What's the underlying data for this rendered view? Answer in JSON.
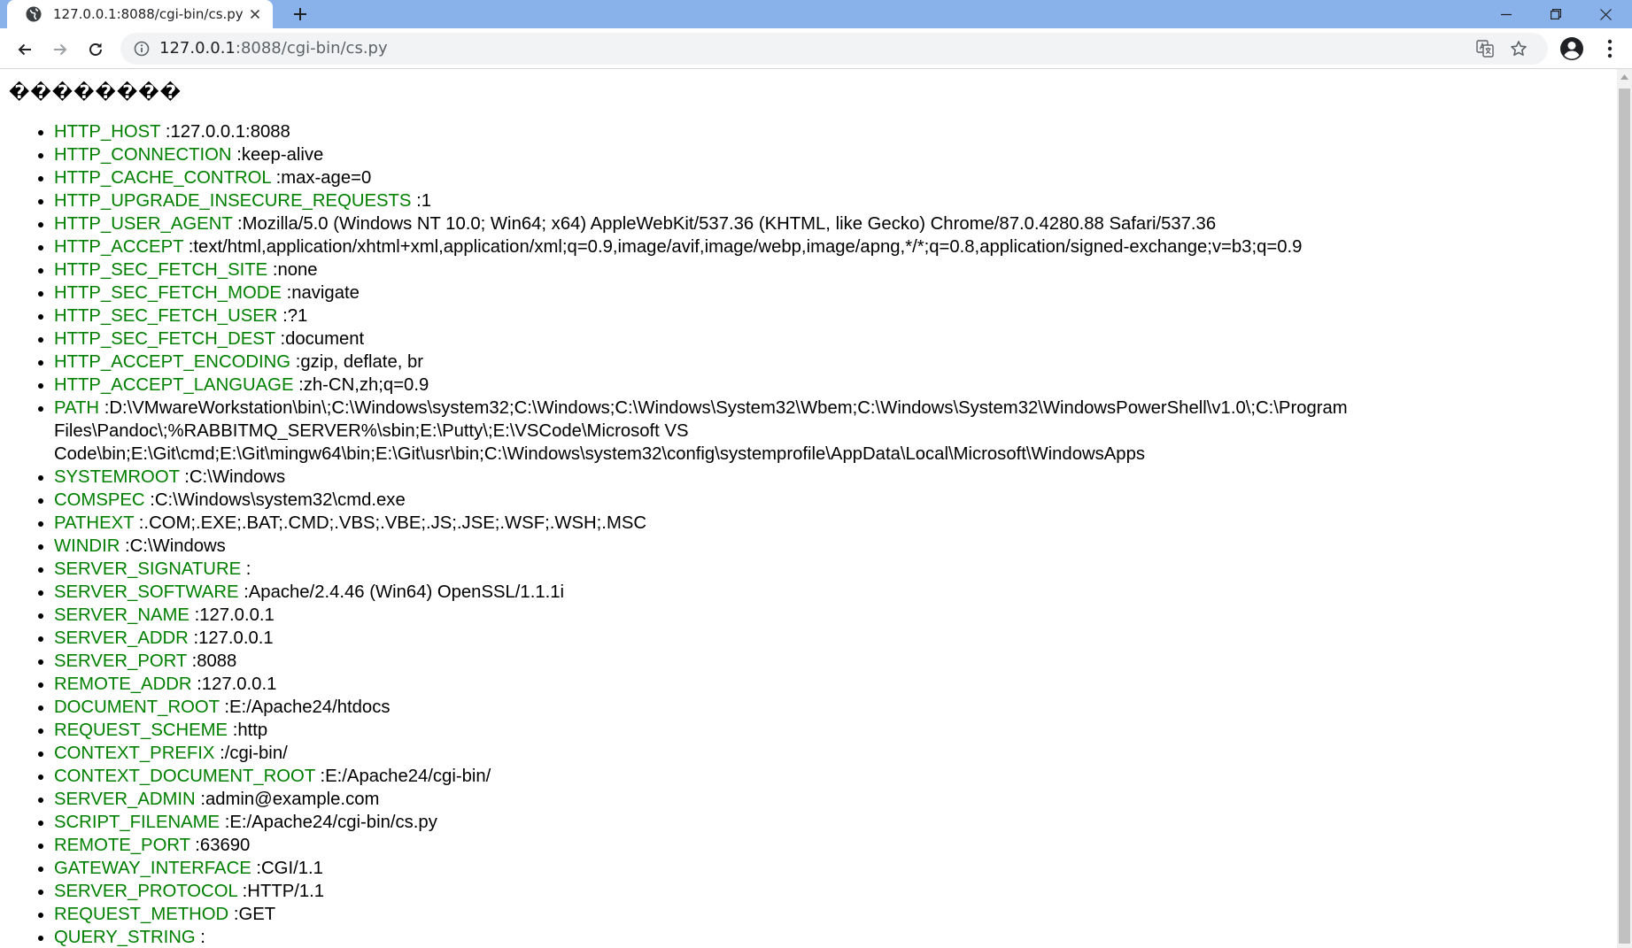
{
  "tab": {
    "title": "127.0.0.1:8088/cgi-bin/cs.py",
    "favicon": "globe-icon"
  },
  "address_bar": {
    "url_host": "127.0.0.1",
    "url_rest": ":8088/cgi-bin/cs.py"
  },
  "icons": {
    "back": "arrow-left-icon",
    "forward": "arrow-right-icon",
    "reload": "reload-icon",
    "info": "info-icon",
    "translate": "translate-icon",
    "bookmark": "star-icon",
    "profile": "account-icon",
    "menu": "kebab-menu-icon"
  },
  "colors": {
    "tab_strip": "#8ab2ea",
    "key_text": "#008000",
    "omnibox": "#f1f3f4"
  },
  "page": {
    "heading": "��������",
    "env": [
      {
        "key": "HTTP_HOST",
        "value": ":127.0.0.1:8088"
      },
      {
        "key": "HTTP_CONNECTION",
        "value": ":keep-alive"
      },
      {
        "key": "HTTP_CACHE_CONTROL",
        "value": ":max-age=0"
      },
      {
        "key": "HTTP_UPGRADE_INSECURE_REQUESTS",
        "value": ":1"
      },
      {
        "key": "HTTP_USER_AGENT",
        "value": ":Mozilla/5.0 (Windows NT 10.0; Win64; x64) AppleWebKit/537.36 (KHTML, like Gecko) Chrome/87.0.4280.88 Safari/537.36"
      },
      {
        "key": "HTTP_ACCEPT",
        "value": ":text/html,application/xhtml+xml,application/xml;q=0.9,image/avif,image/webp,image/apng,*/*;q=0.8,application/signed-exchange;v=b3;q=0.9"
      },
      {
        "key": "HTTP_SEC_FETCH_SITE",
        "value": ":none"
      },
      {
        "key": "HTTP_SEC_FETCH_MODE",
        "value": ":navigate"
      },
      {
        "key": "HTTP_SEC_FETCH_USER",
        "value": ":?1"
      },
      {
        "key": "HTTP_SEC_FETCH_DEST",
        "value": ":document"
      },
      {
        "key": "HTTP_ACCEPT_ENCODING",
        "value": ":gzip, deflate, br"
      },
      {
        "key": "HTTP_ACCEPT_LANGUAGE",
        "value": ":zh-CN,zh;q=0.9"
      },
      {
        "key": "PATH",
        "value": ":D:\\VMwareWorkstation\\bin\\;C:\\Windows\\system32;C:\\Windows;C:\\Windows\\System32\\Wbem;C:\\Windows\\System32\\WindowsPowerShell\\v1.0\\;C:\\Program Files\\Pandoc\\;%RABBITMQ_SERVER%\\sbin;E:\\Putty\\;E:\\VSCode\\Microsoft VS Code\\bin;E:\\Git\\cmd;E:\\Git\\mingw64\\bin;E:\\Git\\usr\\bin;C:\\Windows\\system32\\config\\systemprofile\\AppData\\Local\\Microsoft\\WindowsApps"
      },
      {
        "key": "SYSTEMROOT",
        "value": ":C:\\Windows"
      },
      {
        "key": "COMSPEC",
        "value": ":C:\\Windows\\system32\\cmd.exe"
      },
      {
        "key": "PATHEXT",
        "value": ":.COM;.EXE;.BAT;.CMD;.VBS;.VBE;.JS;.JSE;.WSF;.WSH;.MSC"
      },
      {
        "key": "WINDIR",
        "value": ":C:\\Windows"
      },
      {
        "key": "SERVER_SIGNATURE",
        "value": ":"
      },
      {
        "key": "SERVER_SOFTWARE",
        "value": ":Apache/2.4.46 (Win64) OpenSSL/1.1.1i"
      },
      {
        "key": "SERVER_NAME",
        "value": ":127.0.0.1"
      },
      {
        "key": "SERVER_ADDR",
        "value": ":127.0.0.1"
      },
      {
        "key": "SERVER_PORT",
        "value": ":8088"
      },
      {
        "key": "REMOTE_ADDR",
        "value": ":127.0.0.1"
      },
      {
        "key": "DOCUMENT_ROOT",
        "value": ":E:/Apache24/htdocs"
      },
      {
        "key": "REQUEST_SCHEME",
        "value": ":http"
      },
      {
        "key": "CONTEXT_PREFIX",
        "value": ":/cgi-bin/"
      },
      {
        "key": "CONTEXT_DOCUMENT_ROOT",
        "value": ":E:/Apache24/cgi-bin/"
      },
      {
        "key": "SERVER_ADMIN",
        "value": ":admin@example.com"
      },
      {
        "key": "SCRIPT_FILENAME",
        "value": ":E:/Apache24/cgi-bin/cs.py"
      },
      {
        "key": "REMOTE_PORT",
        "value": ":63690"
      },
      {
        "key": "GATEWAY_INTERFACE",
        "value": ":CGI/1.1"
      },
      {
        "key": "SERVER_PROTOCOL",
        "value": ":HTTP/1.1"
      },
      {
        "key": "REQUEST_METHOD",
        "value": ":GET"
      },
      {
        "key": "QUERY_STRING",
        "value": ":"
      }
    ]
  }
}
